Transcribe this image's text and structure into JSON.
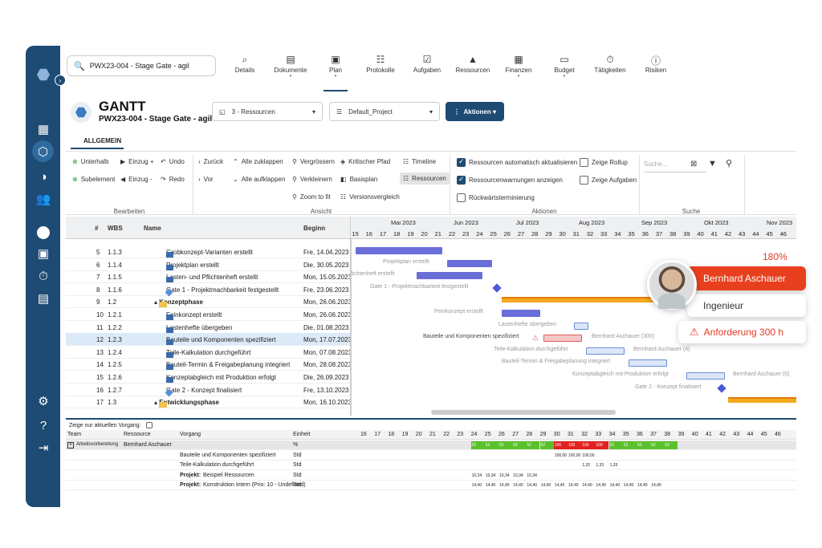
{
  "search": {
    "value": "PWX23-004 - Stage Gate - agil"
  },
  "nav": [
    {
      "label": "Details",
      "icon": "details-icon"
    },
    {
      "label": "Dokumente",
      "icon": "document-icon",
      "dot": true
    },
    {
      "label": "Plan",
      "icon": "plan-icon",
      "dot": true,
      "active": true
    },
    {
      "label": "Protokolle",
      "icon": "protocol-icon"
    },
    {
      "label": "Aufgaben",
      "icon": "task-icon"
    },
    {
      "label": "Ressourcen",
      "icon": "resource-icon"
    },
    {
      "label": "Finanzen",
      "icon": "finance-icon",
      "dot": true
    },
    {
      "label": "Budget",
      "icon": "budget-icon",
      "dot": true
    },
    {
      "label": "Tätigkeiten",
      "icon": "timer-icon"
    },
    {
      "label": "Risiken",
      "icon": "risk-icon"
    }
  ],
  "header": {
    "title": "GANTT",
    "subtitle": "PWX23-004 - Stage Gate - agil"
  },
  "view_select": {
    "value": "3 - Ressourcen"
  },
  "project_select": {
    "value": "Default_Project"
  },
  "actions_button": {
    "label": "Aktionen"
  },
  "tab": {
    "label": "ALLGEMEIN"
  },
  "ribbon": {
    "bearbeiten": {
      "group": "Bearbeiten",
      "unterhalb": "Unterhalb",
      "einzug_plus": "Einzug +",
      "undo": "Undo",
      "subelement": "Subelement",
      "einzug_minus": "Einzug -",
      "redo": "Redo"
    },
    "ansicht": {
      "group": "Ansicht",
      "zurueck": "Zurück",
      "alle_zuklappen": "Alle zuklappen",
      "vergroessern": "Vergrössern",
      "kritischer_pfad": "Kritischer Pfad",
      "timeline": "Timeline",
      "vor": "Vor",
      "alle_aufklappen": "Alle aufklappen",
      "verkleinern": "Verkleinern",
      "basisplan": "Basisplan",
      "ressourcen": "Ressourcen",
      "zoom": "Zoom to fit",
      "versionsvergleich": "Versionsvergleich"
    },
    "aktionen": {
      "group": "Aktionen",
      "res_auto": "Ressourcen automatisch aktualisieren",
      "res_warn": "Ressourcenwarnungen anzeigen",
      "rueckwaerts": "Rückwärtsterminierung",
      "rollup": "Zeige Rollup",
      "aufgaben": "Zeige Aufgaben"
    },
    "suche": {
      "group": "Suche",
      "placeholder": "Suche..."
    }
  },
  "grid": {
    "headers": {
      "num": "#",
      "wbs": "WBS",
      "name": "Name",
      "beginn": "Beginn"
    },
    "rows": [
      {
        "num": "5",
        "wbs": "1.1.3",
        "name": "Grobkonzept-Varianten erstellt",
        "beginn": "Fre, 14.04.2023",
        "kind": "task"
      },
      {
        "num": "6",
        "wbs": "1.1.4",
        "name": "Projektplan erstellt",
        "beginn": "Die, 30.05.2023",
        "kind": "task"
      },
      {
        "num": "7",
        "wbs": "1.1.5",
        "name": "Lasten- und Pflichtenheft erstellt",
        "beginn": "Mon, 15.05.2023",
        "kind": "task"
      },
      {
        "num": "8",
        "wbs": "1.1.6",
        "name": "Gate 1 - Projektmachbarkeit festgestellt",
        "beginn": "Fre, 23.06.2023",
        "kind": "milestone"
      },
      {
        "num": "9",
        "wbs": "1.2",
        "name": "Konzeptphase",
        "beginn": "Mon, 26.06.2023",
        "kind": "folder"
      },
      {
        "num": "10",
        "wbs": "1.2.1",
        "name": "Feinkonzept erstellt",
        "beginn": "Mon, 26.06.2023",
        "kind": "task"
      },
      {
        "num": "11",
        "wbs": "1.2.2",
        "name": "Lastenhefte übergeben",
        "beginn": "Die, 01.08.2023",
        "kind": "task"
      },
      {
        "num": "12",
        "wbs": "1.2.3",
        "name": "Bauteile und Komponenten spezifiziert",
        "beginn": "Mon, 17.07.2023",
        "kind": "task",
        "hl": true
      },
      {
        "num": "13",
        "wbs": "1.2.4",
        "name": "Teile-Kalkulation durchgeführt",
        "beginn": "Mon, 07.08.2023",
        "kind": "task"
      },
      {
        "num": "14",
        "wbs": "1.2.5",
        "name": "Bauteil-Termin & Freigabeplanung integriert",
        "beginn": "Mon, 28.08.2023",
        "kind": "task"
      },
      {
        "num": "15",
        "wbs": "1.2.6",
        "name": "Konzeptabgleich mit Produktion erfolgt",
        "beginn": "Die, 26.09.2023",
        "kind": "task"
      },
      {
        "num": "16",
        "wbs": "1.2.7",
        "name": "Gate 2 - Konzept finalisiert",
        "beginn": "Fre, 13.10.2023",
        "kind": "milestone"
      },
      {
        "num": "17",
        "wbs": "1.3",
        "name": "Entwicklungsphase",
        "beginn": "Mon, 16.10.2023",
        "kind": "folder"
      }
    ]
  },
  "gantt": {
    "months": [
      "Mai 2023",
      "Jun 2023",
      "Jul 2023",
      "Aug 2023",
      "Sep 2023",
      "Okt 2023",
      "Nov 2023"
    ],
    "weeks": [
      "15",
      "16",
      "17",
      "18",
      "19",
      "20",
      "21",
      "22",
      "23",
      "24",
      "25",
      "26",
      "27",
      "28",
      "29",
      "30",
      "31",
      "32",
      "33",
      "34",
      "35",
      "36",
      "37",
      "38",
      "39",
      "40",
      "41",
      "42",
      "43",
      "44",
      "45",
      "46"
    ],
    "labels": {
      "l6": "Projektplan erstellt",
      "l7": "flichtenheft erstellt",
      "l8": "Gate 1 - Projektmachbarkeit festgestellt",
      "l10": "Feinkonzept erstellt",
      "l11": "Lastenhefte übergeben",
      "l12a": "Bauteile und Komponenten spezifiziert",
      "l12b": "Bernhard Aschauer (300)",
      "l13a": "Teile-Kalkulation durchgeführt",
      "l13b": "Bernhard Aschauer (4)",
      "l14": "Bauteil-Termin & Freigabeplanung integriert",
      "l15a": "Konzeptabgleich mit Produktion erfolgt",
      "l15b": "Bernhard Aschauer (0)",
      "l16": "Gate 2 - Konzept finalisiert"
    }
  },
  "popup": {
    "percent": "180%",
    "name": "Bernhard Aschauer",
    "role": "Ingenieur",
    "warning": "Anforderung 300 h"
  },
  "bottom": {
    "checkbox_label": "Zeige nur aktuellen Vorgang:",
    "headers": {
      "team": "Team",
      "resource": "Ressource",
      "vorgang": "Vorgang",
      "einheit": "Einheit"
    },
    "weeks": [
      "16",
      "17",
      "18",
      "19",
      "20",
      "21",
      "22",
      "23",
      "24",
      "25",
      "26",
      "27",
      "28",
      "29",
      "30",
      "31",
      "32",
      "33",
      "34",
      "35",
      "36",
      "37",
      "38",
      "39",
      "40",
      "41",
      "42",
      "43",
      "44",
      "45",
      "46"
    ],
    "rows": [
      {
        "team": "Arbeitsvorbereitung",
        "resource": "Bernhard Aschauer",
        "vorgang": "",
        "einheit": "%"
      },
      {
        "team": "",
        "resource": "",
        "vorgang": "Bauteile und Komponenten spezifiziert",
        "einheit": "Std"
      },
      {
        "team": "",
        "resource": "",
        "vorgang": "Teile-Kalkulation durchgeführt",
        "einheit": "Std"
      },
      {
        "team": "",
        "resource": "",
        "vorgang_bold": "Projekt:",
        "vorgang": " Beispiel Ressourcen",
        "einheit": "Std"
      },
      {
        "team": "",
        "resource": "",
        "vorgang_bold": "Projekt:",
        "vorgang": " Konstruktion Intern (Prio: 10 - Undefined)",
        "einheit": "Std"
      }
    ],
    "pct_values": [
      "52",
      "52",
      "52",
      "52",
      "52",
      "52",
      "100",
      "100",
      "100",
      "100",
      "52",
      "52",
      "52",
      "52",
      "52"
    ],
    "row1_values": [
      "100,00",
      "100,00",
      "100,00"
    ],
    "row2_values": [
      "1,33",
      "1,33",
      "1,33"
    ],
    "row3_values": [
      "10,34",
      "10,34",
      "10,34",
      "10,34",
      "10,34"
    ],
    "row4_values": [
      "14,40",
      "14,40",
      "14,40",
      "14,40",
      "14,40",
      "14,40",
      "14,40",
      "14,40",
      "14,40",
      "14,40",
      "14,40",
      "14,40",
      "14,40",
      "14,40"
    ]
  }
}
